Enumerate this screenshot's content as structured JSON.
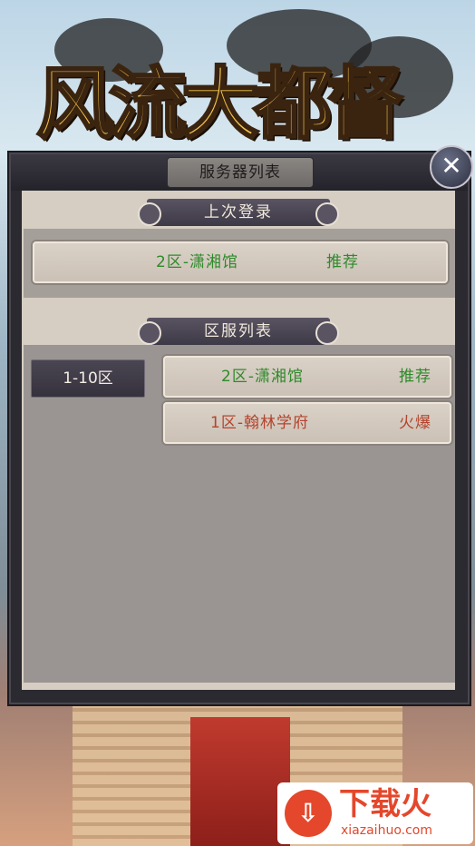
{
  "app": {
    "title": "风流大都督"
  },
  "panel": {
    "header": "服务器列表",
    "close_icon": "close-icon"
  },
  "last_login": {
    "label": "上次登录",
    "server": {
      "name": "2区-潇湘馆",
      "tag": "推荐"
    }
  },
  "server_list": {
    "label": "区服列表",
    "region": "1-10区",
    "servers": [
      {
        "name": "2区-潇湘馆",
        "tag": "推荐"
      },
      {
        "name": "1区-翰林学府",
        "tag": "火爆"
      }
    ]
  },
  "watermark": {
    "text": "下载火",
    "url_text": "xiazaihuo.com"
  },
  "colors": {
    "recommend": "#2e8a2a",
    "hot": "#b4442d"
  }
}
